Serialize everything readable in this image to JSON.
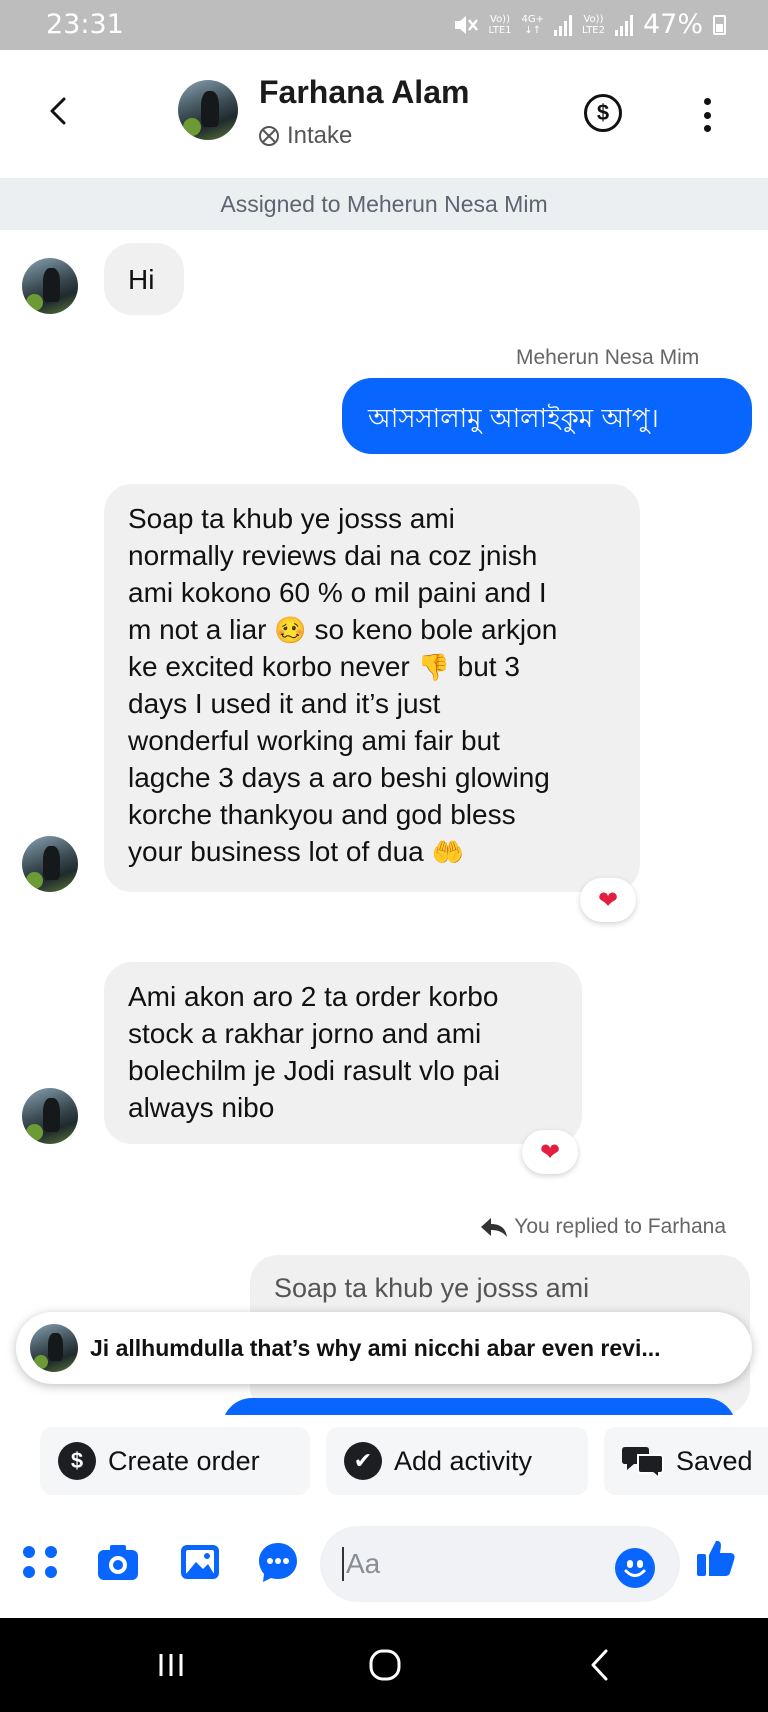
{
  "status_bar": {
    "time": "23:31",
    "net_line1": "Vo))",
    "net_line2": "LTE1",
    "net_type": "4G+",
    "net2_line1": "Vo))",
    "net2_line2": "LTE2",
    "battery": "47%"
  },
  "header": {
    "contact_name": "Farhana Alam",
    "contact_status": "Intake",
    "dollar_symbol": "$"
  },
  "assigned": "Assigned to Meherun Nesa Mim",
  "messages": [
    {
      "from": "contact",
      "text": "Hi"
    },
    {
      "from": "agent",
      "sender": "Meherun Nesa Mim",
      "text": "আসসালামু আলাইকুম আপু।"
    },
    {
      "from": "contact",
      "lines": [
        "Soap ta khub ye josss ami",
        "normally reviews dai na coz jnish",
        "ami kokono 60 % o mil paini and I",
        "m not a liar",
        "so keno bole arkjon",
        "ke excited korbo never",
        "but 3",
        "days I used it and it’s just",
        "wonderful working ami fair but",
        "lagche 3 days a aro beshi glowing",
        "korche thankyou and god bless",
        "your business lot of dua"
      ],
      "emoji_1": "🥴",
      "emoji_2": "👎",
      "emoji_3": "🤲",
      "reaction": "❤"
    },
    {
      "from": "contact",
      "lines": [
        "Ami akon aro 2 ta order korbo",
        "stock a rakhar jorno and ami",
        "bolechilm je Jodi rasult vlo pai",
        "always nibo"
      ],
      "reaction": "❤"
    }
  ],
  "reply": {
    "label": "You replied to Farhana",
    "quoted_text": "Soap ta khub ye josss ami"
  },
  "preview": {
    "text": "Ji allhumdulla that’s why ami nicchi abar even revi..."
  },
  "quick_actions": [
    {
      "label": "Create order",
      "icon": "$"
    },
    {
      "label": "Add activity",
      "icon": "✔"
    },
    {
      "label": "Saved",
      "icon": "chat-bubbles"
    }
  ],
  "composer": {
    "placeholder": "Aa"
  }
}
